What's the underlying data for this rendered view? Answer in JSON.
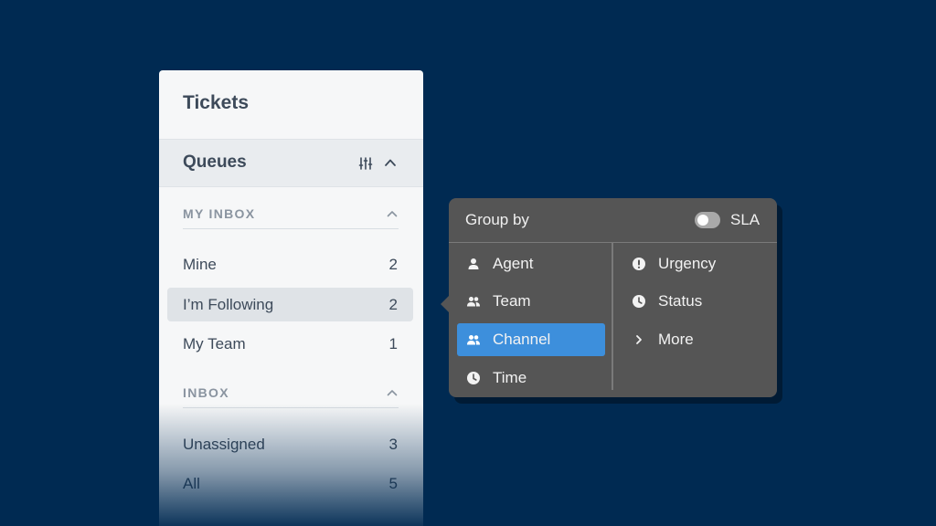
{
  "panel": {
    "title": "Tickets",
    "queues_label": "Queues",
    "sections": [
      {
        "label": "MY INBOX",
        "items": [
          {
            "label": "Mine",
            "count": "2"
          },
          {
            "label": "I’m Following",
            "count": "2"
          },
          {
            "label": "My Team",
            "count": "1"
          }
        ]
      },
      {
        "label": "INBOX",
        "items": [
          {
            "label": "Unassigned",
            "count": "3"
          },
          {
            "label": "All",
            "count": "5"
          }
        ]
      }
    ],
    "active_item": "I’m Following"
  },
  "popover": {
    "title": "Group by",
    "toggle_label": "SLA",
    "toggle_on": false,
    "left_options": [
      {
        "label": "Agent",
        "icon": "person-icon"
      },
      {
        "label": "Team",
        "icon": "group-icon"
      },
      {
        "label": "Channel",
        "icon": "group-icon"
      },
      {
        "label": "Time",
        "icon": "clock-icon"
      }
    ],
    "right_options": [
      {
        "label": "Urgency",
        "icon": "alert-icon"
      },
      {
        "label": "Status",
        "icon": "clock-icon"
      },
      {
        "label": "More",
        "icon": "chevron-right-icon"
      }
    ],
    "selected": "Channel"
  },
  "colors": {
    "background": "#002a52",
    "panel": "#f6f7f8",
    "popover": "#555555",
    "accent": "#3d8fdc"
  }
}
